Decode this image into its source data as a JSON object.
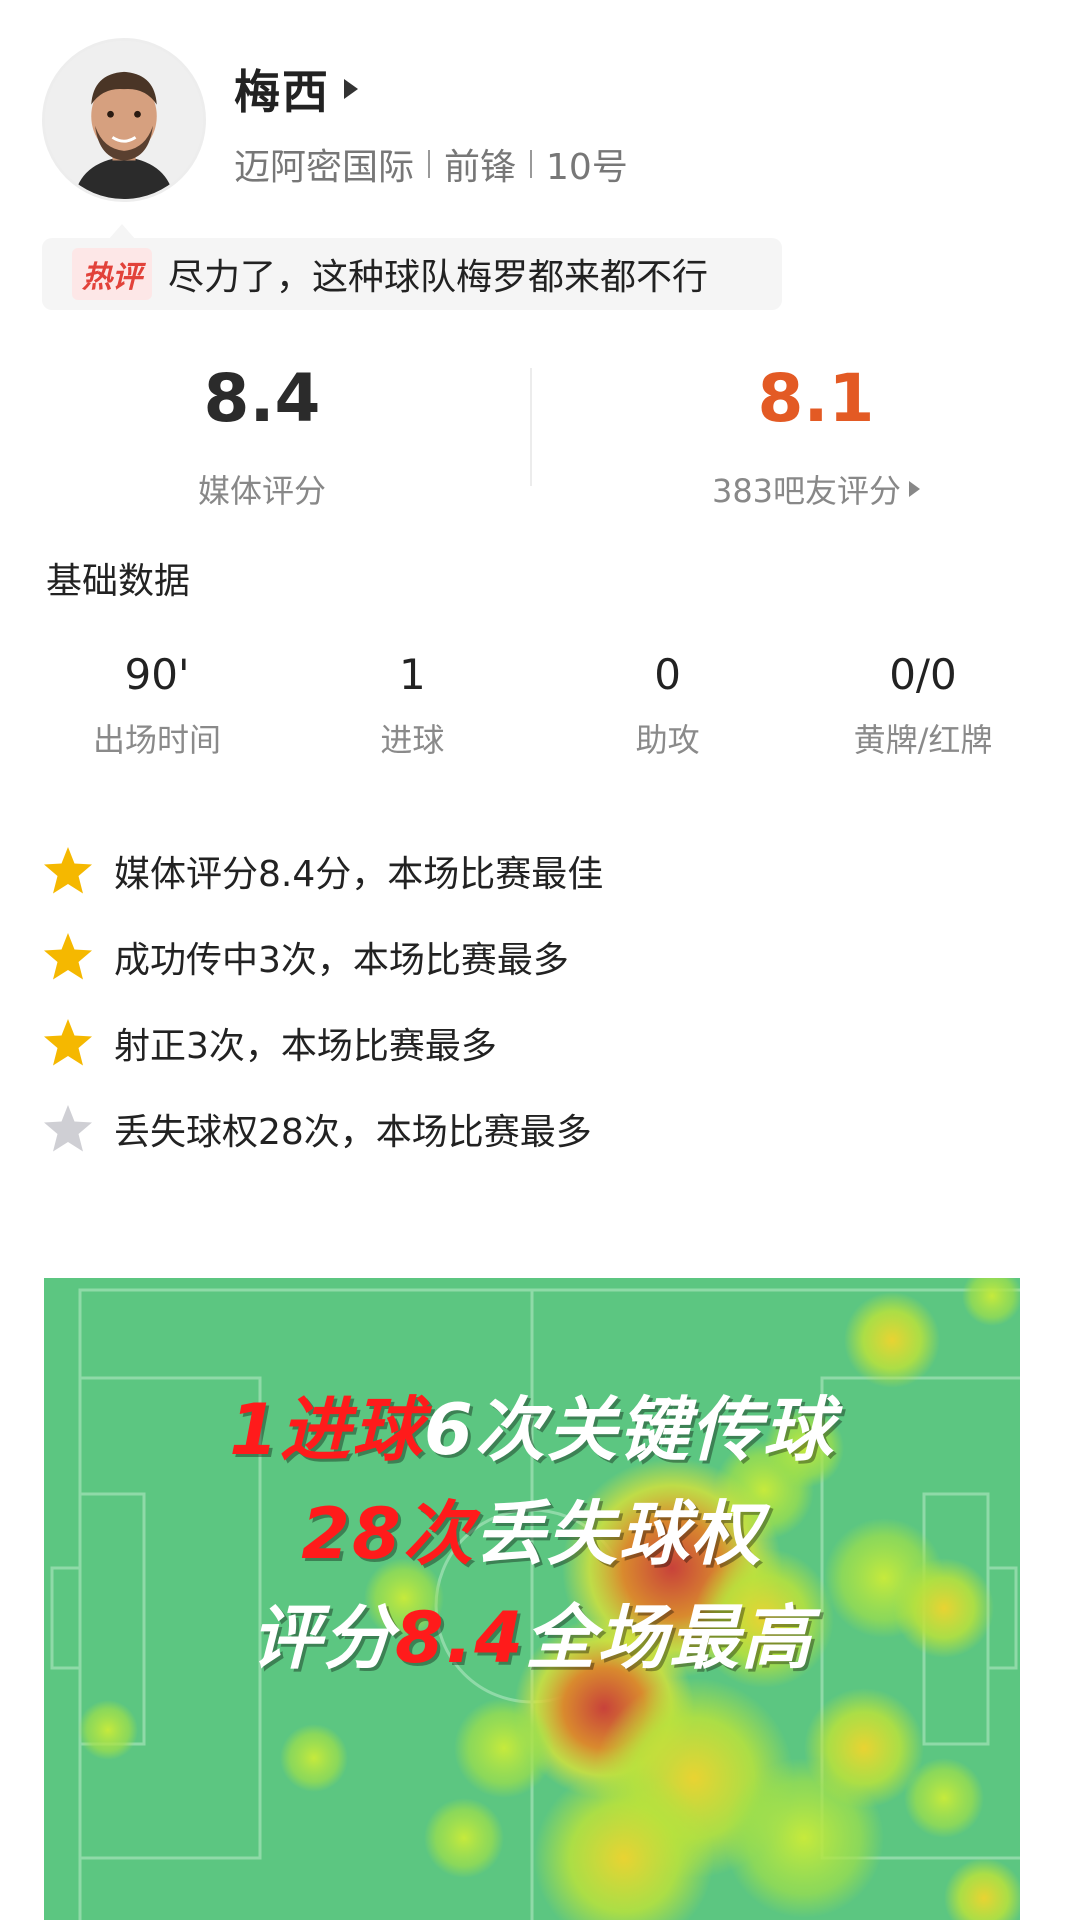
{
  "player": {
    "name": "梅西",
    "team": "迈阿密国际",
    "position": "前锋",
    "number": "10号"
  },
  "hot_comment": {
    "badge": "热评",
    "text": "尽力了，这种球队梅罗都来都不行"
  },
  "ratings": {
    "media_score": "8.4",
    "media_label": "媒体评分",
    "fan_score": "8.1",
    "fan_label": "383吧友评分"
  },
  "basic": {
    "title": "基础数据",
    "stats": [
      {
        "value": "90'",
        "label": "出场时间"
      },
      {
        "value": "1",
        "label": "进球"
      },
      {
        "value": "0",
        "label": "助攻"
      },
      {
        "value": "0/0",
        "label": "黄牌/红牌"
      }
    ]
  },
  "highlights": [
    {
      "text": "媒体评分8.4分，本场比赛最佳",
      "star": "gold-star-icon"
    },
    {
      "text": "成功传中3次，本场比赛最多",
      "star": "gold-star-icon"
    },
    {
      "text": "射正3次，本场比赛最多",
      "star": "gold-star-icon"
    },
    {
      "text": "丢失球权28次，本场比赛最多",
      "star": "grey-star-icon"
    }
  ],
  "overlay": {
    "line1": [
      {
        "text": "1进球",
        "color": "red"
      },
      {
        "text": "6次关键传球",
        "color": "white"
      }
    ],
    "line2": [
      {
        "text": "28次",
        "color": "red"
      },
      {
        "text": "丢失球权",
        "color": "white"
      }
    ],
    "line3": [
      {
        "text": "评分",
        "color": "white"
      },
      {
        "text": "8.4",
        "color": "red"
      },
      {
        "text": "全场最高",
        "color": "white"
      }
    ]
  },
  "colors": {
    "fan_score": "#e35a24",
    "pitch": "#5cc681",
    "overlay_red": "#ff1b1b",
    "star_gold": "#f5b800",
    "star_grey": "#cfcfd4"
  }
}
